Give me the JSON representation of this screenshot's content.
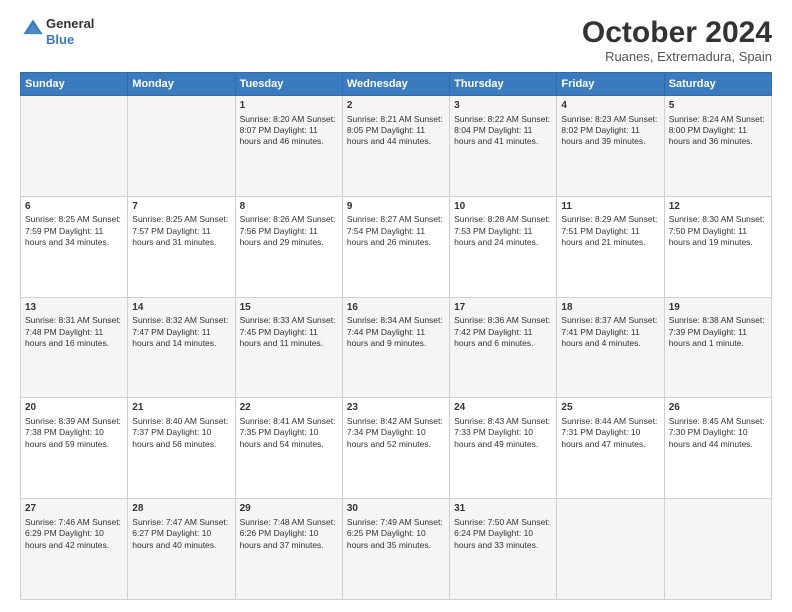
{
  "logo": {
    "line1": "General",
    "line2": "Blue"
  },
  "title": "October 2024",
  "subtitle": "Ruanes, Extremadura, Spain",
  "days_of_week": [
    "Sunday",
    "Monday",
    "Tuesday",
    "Wednesday",
    "Thursday",
    "Friday",
    "Saturday"
  ],
  "weeks": [
    [
      {
        "day": "",
        "info": ""
      },
      {
        "day": "",
        "info": ""
      },
      {
        "day": "1",
        "info": "Sunrise: 8:20 AM\nSunset: 8:07 PM\nDaylight: 11 hours and 46 minutes."
      },
      {
        "day": "2",
        "info": "Sunrise: 8:21 AM\nSunset: 8:05 PM\nDaylight: 11 hours and 44 minutes."
      },
      {
        "day": "3",
        "info": "Sunrise: 8:22 AM\nSunset: 8:04 PM\nDaylight: 11 hours and 41 minutes."
      },
      {
        "day": "4",
        "info": "Sunrise: 8:23 AM\nSunset: 8:02 PM\nDaylight: 11 hours and 39 minutes."
      },
      {
        "day": "5",
        "info": "Sunrise: 8:24 AM\nSunset: 8:00 PM\nDaylight: 11 hours and 36 minutes."
      }
    ],
    [
      {
        "day": "6",
        "info": "Sunrise: 8:25 AM\nSunset: 7:59 PM\nDaylight: 11 hours and 34 minutes."
      },
      {
        "day": "7",
        "info": "Sunrise: 8:25 AM\nSunset: 7:57 PM\nDaylight: 11 hours and 31 minutes."
      },
      {
        "day": "8",
        "info": "Sunrise: 8:26 AM\nSunset: 7:56 PM\nDaylight: 11 hours and 29 minutes."
      },
      {
        "day": "9",
        "info": "Sunrise: 8:27 AM\nSunset: 7:54 PM\nDaylight: 11 hours and 26 minutes."
      },
      {
        "day": "10",
        "info": "Sunrise: 8:28 AM\nSunset: 7:53 PM\nDaylight: 11 hours and 24 minutes."
      },
      {
        "day": "11",
        "info": "Sunrise: 8:29 AM\nSunset: 7:51 PM\nDaylight: 11 hours and 21 minutes."
      },
      {
        "day": "12",
        "info": "Sunrise: 8:30 AM\nSunset: 7:50 PM\nDaylight: 11 hours and 19 minutes."
      }
    ],
    [
      {
        "day": "13",
        "info": "Sunrise: 8:31 AM\nSunset: 7:48 PM\nDaylight: 11 hours and 16 minutes."
      },
      {
        "day": "14",
        "info": "Sunrise: 8:32 AM\nSunset: 7:47 PM\nDaylight: 11 hours and 14 minutes."
      },
      {
        "day": "15",
        "info": "Sunrise: 8:33 AM\nSunset: 7:45 PM\nDaylight: 11 hours and 11 minutes."
      },
      {
        "day": "16",
        "info": "Sunrise: 8:34 AM\nSunset: 7:44 PM\nDaylight: 11 hours and 9 minutes."
      },
      {
        "day": "17",
        "info": "Sunrise: 8:36 AM\nSunset: 7:42 PM\nDaylight: 11 hours and 6 minutes."
      },
      {
        "day": "18",
        "info": "Sunrise: 8:37 AM\nSunset: 7:41 PM\nDaylight: 11 hours and 4 minutes."
      },
      {
        "day": "19",
        "info": "Sunrise: 8:38 AM\nSunset: 7:39 PM\nDaylight: 11 hours and 1 minute."
      }
    ],
    [
      {
        "day": "20",
        "info": "Sunrise: 8:39 AM\nSunset: 7:38 PM\nDaylight: 10 hours and 59 minutes."
      },
      {
        "day": "21",
        "info": "Sunrise: 8:40 AM\nSunset: 7:37 PM\nDaylight: 10 hours and 56 minutes."
      },
      {
        "day": "22",
        "info": "Sunrise: 8:41 AM\nSunset: 7:35 PM\nDaylight: 10 hours and 54 minutes."
      },
      {
        "day": "23",
        "info": "Sunrise: 8:42 AM\nSunset: 7:34 PM\nDaylight: 10 hours and 52 minutes."
      },
      {
        "day": "24",
        "info": "Sunrise: 8:43 AM\nSunset: 7:33 PM\nDaylight: 10 hours and 49 minutes."
      },
      {
        "day": "25",
        "info": "Sunrise: 8:44 AM\nSunset: 7:31 PM\nDaylight: 10 hours and 47 minutes."
      },
      {
        "day": "26",
        "info": "Sunrise: 8:45 AM\nSunset: 7:30 PM\nDaylight: 10 hours and 44 minutes."
      }
    ],
    [
      {
        "day": "27",
        "info": "Sunrise: 7:46 AM\nSunset: 6:29 PM\nDaylight: 10 hours and 42 minutes."
      },
      {
        "day": "28",
        "info": "Sunrise: 7:47 AM\nSunset: 6:27 PM\nDaylight: 10 hours and 40 minutes."
      },
      {
        "day": "29",
        "info": "Sunrise: 7:48 AM\nSunset: 6:26 PM\nDaylight: 10 hours and 37 minutes."
      },
      {
        "day": "30",
        "info": "Sunrise: 7:49 AM\nSunset: 6:25 PM\nDaylight: 10 hours and 35 minutes."
      },
      {
        "day": "31",
        "info": "Sunrise: 7:50 AM\nSunset: 6:24 PM\nDaylight: 10 hours and 33 minutes."
      },
      {
        "day": "",
        "info": ""
      },
      {
        "day": "",
        "info": ""
      }
    ]
  ]
}
